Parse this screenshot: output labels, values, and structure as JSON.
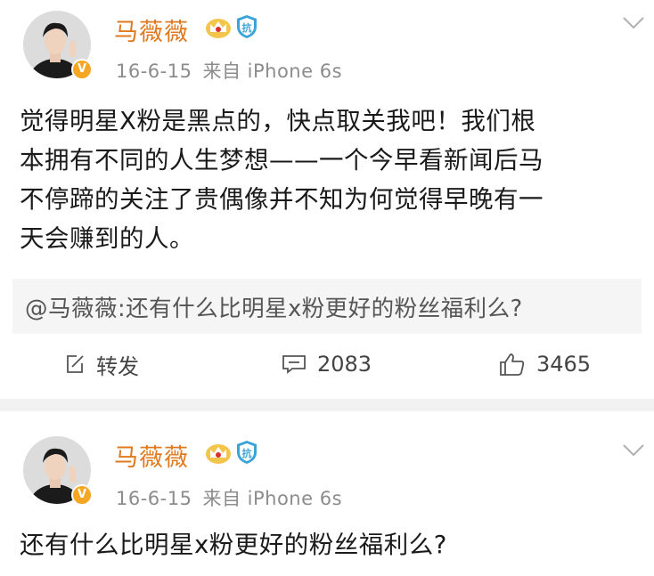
{
  "posts": [
    {
      "author": "马薇薇",
      "date": "16-6-15",
      "source": "来自 iPhone 6s",
      "text_lines": [
        "觉得明星X粉是黑点的，快点取关我吧！我们根",
        "本拥有不同的人生梦想——一个今早看新闻后马",
        "不停蹄的关注了贵偶像并不知为何觉得早晚有一",
        "天会赚到的人。"
      ],
      "quote": "@马薇薇:还有什么比明星x粉更好的粉丝福利么?",
      "actions": {
        "repost_label": "转发",
        "comment_count": "2083",
        "like_count": "3465"
      }
    },
    {
      "author": "马薇薇",
      "date": "16-6-15",
      "source": "来自 iPhone 6s",
      "text_lines": [
        "还有什么比明星x粉更好的粉丝福利么?"
      ]
    }
  ],
  "icons": {
    "verified_badge": "verified-v-icon",
    "crown": "crown-icon",
    "shield": "anti-fake-shield-icon",
    "menu": "chevron-down-icon"
  },
  "colors": {
    "username": "#e07a1f",
    "meta": "#8c8c8c",
    "badge": "#f5a623",
    "quote_bg": "#f5f5f5",
    "separator": "#f2f2f2"
  }
}
